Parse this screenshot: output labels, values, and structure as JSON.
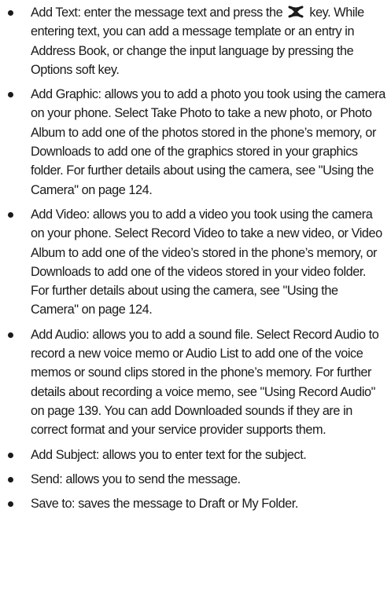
{
  "items": [
    {
      "text_before": "Add Text: enter the message text and press the",
      "key_icon": "cancel-key-icon",
      "text_after": "key. While entering text, you can add a message template or an entry in Address Book, or change the input language by pressing the Options soft key."
    },
    {
      "text": "Add Graphic: allows you to add a photo you took using the camera on your phone. Select Take Photo to take a new photo, or Photo Album to add one of the photos stored in the phone’s memory, or Downloads to add one of the graphics stored in your graphics folder. For further details about using the camera, see \"Using the Camera\" on page 124."
    },
    {
      "text": "Add Video: allows you to add a video you took using the camera on your phone. Select Record Video to take a new video, or Video Album to add one of the video’s stored in the phone’s memory, or Downloads to add one of the videos stored in your video folder. For further details about using the camera, see \"Using the Camera\" on page 124."
    },
    {
      "text": "Add Audio: allows you to add a sound file. Select Record Audio to record a new voice memo or Audio List to add one of the voice memos or sound clips stored in the phone’s memory. For further details about recording a voice memo, see \"Using Record Audio\" on page 139. You can add Downloaded sounds if they are in correct format and your service provider supports them."
    },
    {
      "text": "Add Subject: allows you to enter text for the subject."
    },
    {
      "text": "Send: allows you to send the message."
    },
    {
      "text": "Save to: saves the message to Draft or My Folder."
    }
  ]
}
